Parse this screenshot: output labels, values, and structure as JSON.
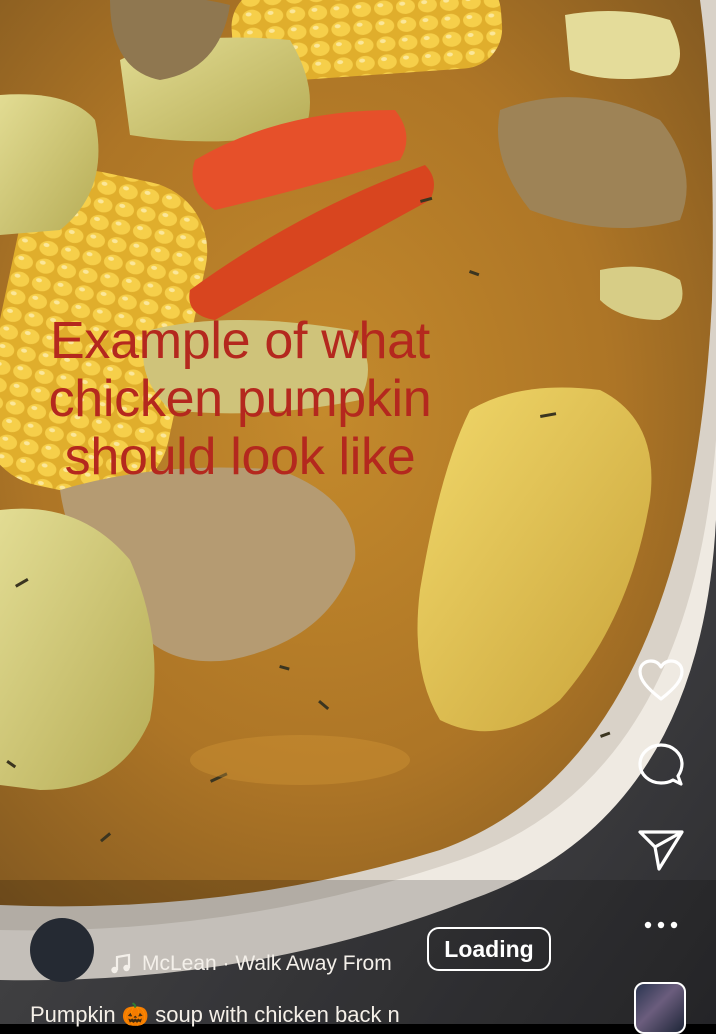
{
  "overlay": {
    "line1": "Example of what",
    "line2": "chicken pumpkin",
    "line3": "should look like"
  },
  "actions": {
    "like": "heart-icon",
    "comment": "comment-icon",
    "share": "send-icon",
    "more": "more-icon"
  },
  "audio": {
    "track": "McLean · Walk Away From",
    "icon": "music-note-icon"
  },
  "loading_label": "Loading",
  "caption": "Pumpkin 🎃 soup with chicken back n",
  "colors": {
    "overlay_text": "#b4281e",
    "broth": "#b27a25",
    "bowl": "#efeae2"
  }
}
